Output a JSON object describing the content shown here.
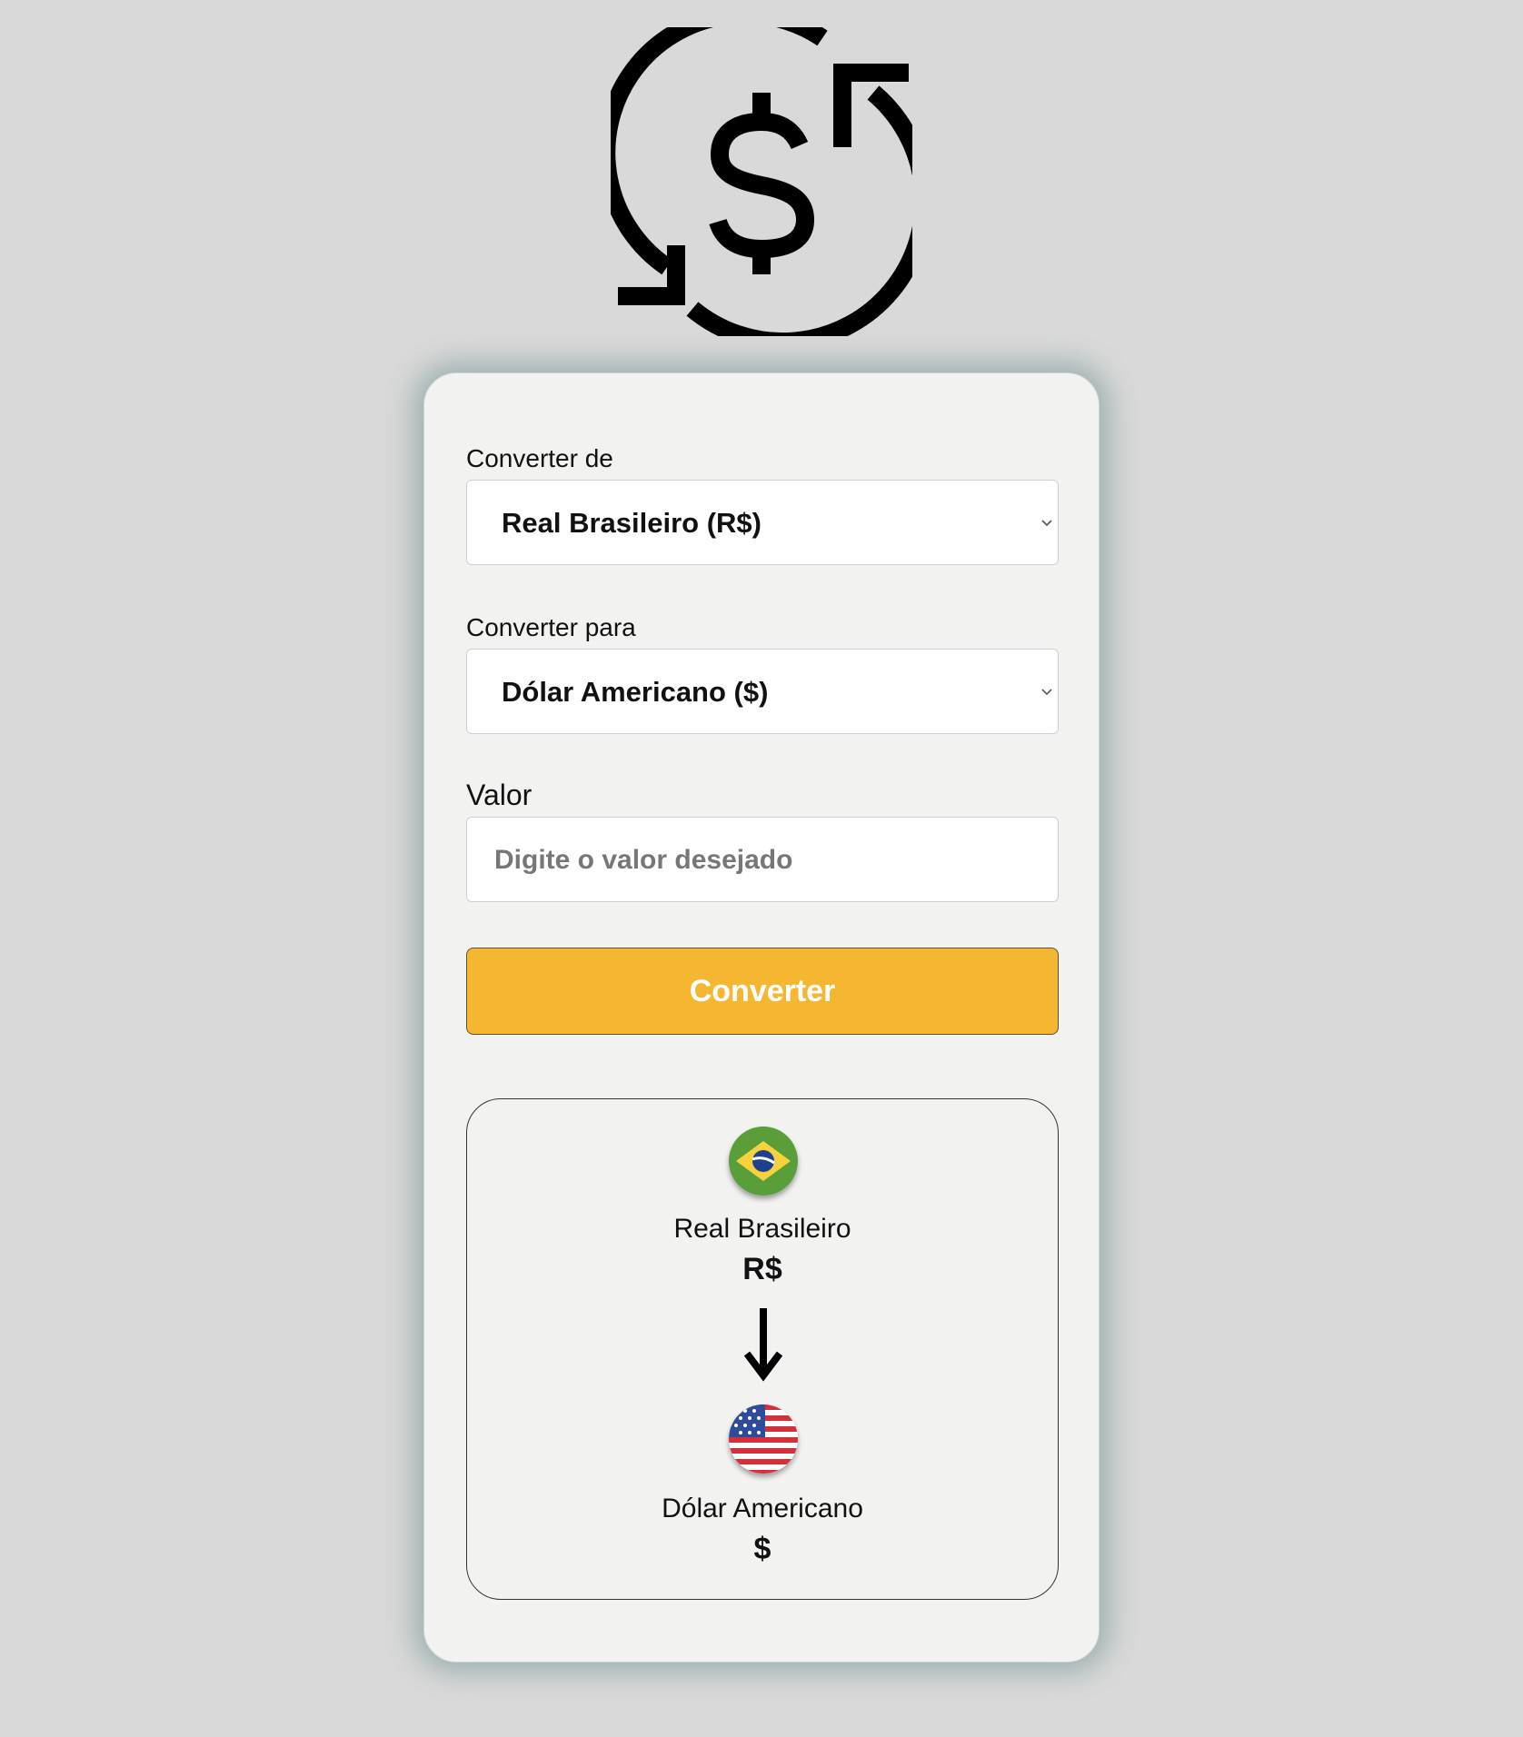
{
  "logo": {
    "icon": "currency-exchange-icon"
  },
  "form": {
    "from_label": "Converter de",
    "from_value": "Real Brasileiro (R$)",
    "to_label": "Converter para",
    "to_value": "Dólar Americano ($)",
    "value_label": "Valor",
    "value_placeholder": "Digite o valor desejado",
    "convert_button": "Converter"
  },
  "result": {
    "from": {
      "flag": "brazil-flag-icon",
      "name": "Real Brasileiro",
      "symbol": "R$"
    },
    "arrow": "arrow-down-icon",
    "to": {
      "flag": "usa-flag-icon",
      "name": "Dólar Americano",
      "symbol": "$"
    }
  },
  "colors": {
    "background": "#d9d9d9",
    "card": "#f2f3f1",
    "button": "#f5b632",
    "button_text": "#ffffff"
  }
}
